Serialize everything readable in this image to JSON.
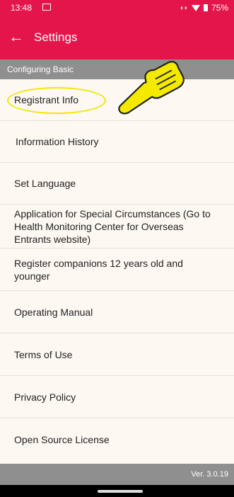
{
  "status": {
    "time": "13:48",
    "battery": "75%"
  },
  "appbar": {
    "back_icon": "arrow-left-icon",
    "title": "Settings"
  },
  "section_header": "Configuring Basic",
  "items": [
    {
      "label": "Registrant Info"
    },
    {
      "label": "Information History"
    },
    {
      "label": "Set Language"
    },
    {
      "label": "Application for Special Circumstances (Go to Health Monitoring Center for Overseas Entrants website)"
    },
    {
      "label": "Register companions 12 years old and younger"
    },
    {
      "label": "Operating Manual"
    },
    {
      "label": "Terms of Use"
    },
    {
      "label": "Privacy Policy"
    },
    {
      "label": "Open Source License"
    }
  ],
  "version": "Ver. 3.0.19",
  "colors": {
    "accent": "#e4154a",
    "section": "#8f8f8f",
    "background": "#fdf8f2",
    "highlight": "#f2e600"
  },
  "annotation": {
    "icon": "pointing-hand-icon"
  }
}
